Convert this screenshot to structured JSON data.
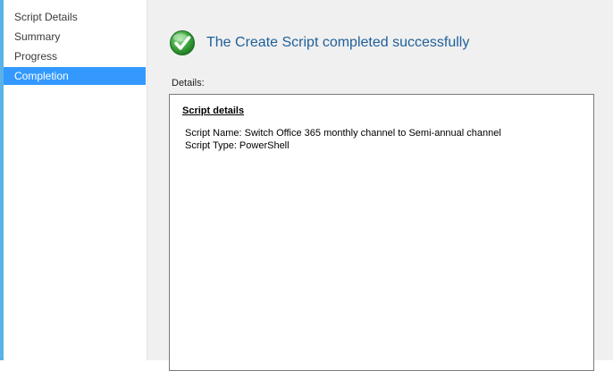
{
  "sidebar": {
    "items": [
      {
        "label": "Script Details"
      },
      {
        "label": "Summary"
      },
      {
        "label": "Progress"
      },
      {
        "label": "Completion"
      }
    ]
  },
  "status": {
    "icon": "check-circle-icon",
    "message": "The Create Script completed successfully",
    "color": "#1f5f9a",
    "icon_color": "#3fa43f"
  },
  "details": {
    "label": "Details:",
    "section_heading": "Script details",
    "lines": [
      "Script Name: Switch Office 365 monthly channel to Semi-annual channel",
      "Script Type: PowerShell"
    ]
  },
  "colors": {
    "selected_bg": "#3399ff",
    "accent": "#5ab2e6"
  }
}
